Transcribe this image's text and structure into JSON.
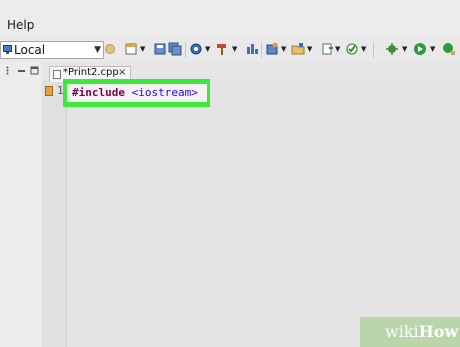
{
  "menubar": {
    "help_label": "Help"
  },
  "toolbar": {
    "target_value": "Local",
    "icons": [
      "new-file-icon",
      "save-icon",
      "save-all-icon",
      "build-icon",
      "hammer-icon",
      "debug-icon",
      "new-class-icon",
      "new-folder-icon",
      "new-source-icon",
      "run-icon",
      "external-tool-icon",
      "debug-run-icon"
    ]
  },
  "editor": {
    "tab_label": "*Print2.cpp",
    "tab_close": "×",
    "line_number": "1",
    "code_keyword": "#include",
    "code_header": "<iostream>"
  },
  "watermark": {
    "part1": "wiki",
    "part2": "How"
  },
  "colors": {
    "highlight": "#3ee83a",
    "keyword": "#7f0055",
    "string": "#2a00ff"
  }
}
